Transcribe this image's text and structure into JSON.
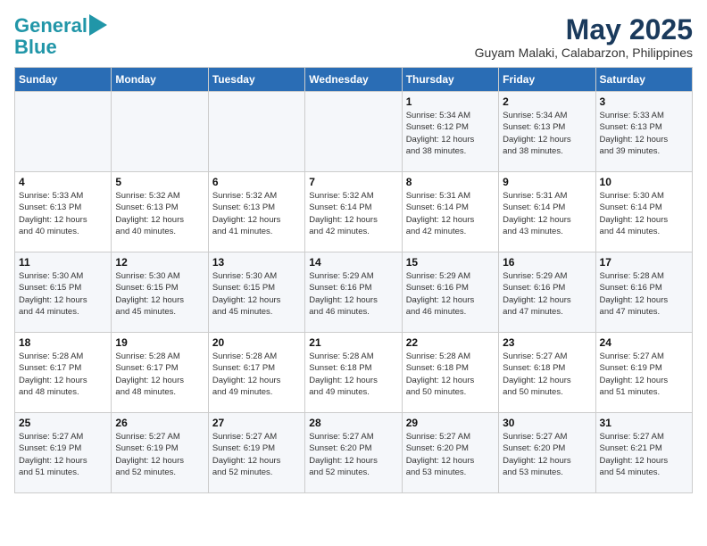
{
  "header": {
    "logo_line1": "General",
    "logo_line2": "Blue",
    "month_title": "May 2025",
    "location": "Guyam Malaki, Calabarzon, Philippines"
  },
  "days_of_week": [
    "Sunday",
    "Monday",
    "Tuesday",
    "Wednesday",
    "Thursday",
    "Friday",
    "Saturday"
  ],
  "weeks": [
    [
      {
        "day": "",
        "info": ""
      },
      {
        "day": "",
        "info": ""
      },
      {
        "day": "",
        "info": ""
      },
      {
        "day": "",
        "info": ""
      },
      {
        "day": "1",
        "info": "Sunrise: 5:34 AM\nSunset: 6:12 PM\nDaylight: 12 hours\nand 38 minutes."
      },
      {
        "day": "2",
        "info": "Sunrise: 5:34 AM\nSunset: 6:13 PM\nDaylight: 12 hours\nand 38 minutes."
      },
      {
        "day": "3",
        "info": "Sunrise: 5:33 AM\nSunset: 6:13 PM\nDaylight: 12 hours\nand 39 minutes."
      }
    ],
    [
      {
        "day": "4",
        "info": "Sunrise: 5:33 AM\nSunset: 6:13 PM\nDaylight: 12 hours\nand 40 minutes."
      },
      {
        "day": "5",
        "info": "Sunrise: 5:32 AM\nSunset: 6:13 PM\nDaylight: 12 hours\nand 40 minutes."
      },
      {
        "day": "6",
        "info": "Sunrise: 5:32 AM\nSunset: 6:13 PM\nDaylight: 12 hours\nand 41 minutes."
      },
      {
        "day": "7",
        "info": "Sunrise: 5:32 AM\nSunset: 6:14 PM\nDaylight: 12 hours\nand 42 minutes."
      },
      {
        "day": "8",
        "info": "Sunrise: 5:31 AM\nSunset: 6:14 PM\nDaylight: 12 hours\nand 42 minutes."
      },
      {
        "day": "9",
        "info": "Sunrise: 5:31 AM\nSunset: 6:14 PM\nDaylight: 12 hours\nand 43 minutes."
      },
      {
        "day": "10",
        "info": "Sunrise: 5:30 AM\nSunset: 6:14 PM\nDaylight: 12 hours\nand 44 minutes."
      }
    ],
    [
      {
        "day": "11",
        "info": "Sunrise: 5:30 AM\nSunset: 6:15 PM\nDaylight: 12 hours\nand 44 minutes."
      },
      {
        "day": "12",
        "info": "Sunrise: 5:30 AM\nSunset: 6:15 PM\nDaylight: 12 hours\nand 45 minutes."
      },
      {
        "day": "13",
        "info": "Sunrise: 5:30 AM\nSunset: 6:15 PM\nDaylight: 12 hours\nand 45 minutes."
      },
      {
        "day": "14",
        "info": "Sunrise: 5:29 AM\nSunset: 6:16 PM\nDaylight: 12 hours\nand 46 minutes."
      },
      {
        "day": "15",
        "info": "Sunrise: 5:29 AM\nSunset: 6:16 PM\nDaylight: 12 hours\nand 46 minutes."
      },
      {
        "day": "16",
        "info": "Sunrise: 5:29 AM\nSunset: 6:16 PM\nDaylight: 12 hours\nand 47 minutes."
      },
      {
        "day": "17",
        "info": "Sunrise: 5:28 AM\nSunset: 6:16 PM\nDaylight: 12 hours\nand 47 minutes."
      }
    ],
    [
      {
        "day": "18",
        "info": "Sunrise: 5:28 AM\nSunset: 6:17 PM\nDaylight: 12 hours\nand 48 minutes."
      },
      {
        "day": "19",
        "info": "Sunrise: 5:28 AM\nSunset: 6:17 PM\nDaylight: 12 hours\nand 48 minutes."
      },
      {
        "day": "20",
        "info": "Sunrise: 5:28 AM\nSunset: 6:17 PM\nDaylight: 12 hours\nand 49 minutes."
      },
      {
        "day": "21",
        "info": "Sunrise: 5:28 AM\nSunset: 6:18 PM\nDaylight: 12 hours\nand 49 minutes."
      },
      {
        "day": "22",
        "info": "Sunrise: 5:28 AM\nSunset: 6:18 PM\nDaylight: 12 hours\nand 50 minutes."
      },
      {
        "day": "23",
        "info": "Sunrise: 5:27 AM\nSunset: 6:18 PM\nDaylight: 12 hours\nand 50 minutes."
      },
      {
        "day": "24",
        "info": "Sunrise: 5:27 AM\nSunset: 6:19 PM\nDaylight: 12 hours\nand 51 minutes."
      }
    ],
    [
      {
        "day": "25",
        "info": "Sunrise: 5:27 AM\nSunset: 6:19 PM\nDaylight: 12 hours\nand 51 minutes."
      },
      {
        "day": "26",
        "info": "Sunrise: 5:27 AM\nSunset: 6:19 PM\nDaylight: 12 hours\nand 52 minutes."
      },
      {
        "day": "27",
        "info": "Sunrise: 5:27 AM\nSunset: 6:19 PM\nDaylight: 12 hours\nand 52 minutes."
      },
      {
        "day": "28",
        "info": "Sunrise: 5:27 AM\nSunset: 6:20 PM\nDaylight: 12 hours\nand 52 minutes."
      },
      {
        "day": "29",
        "info": "Sunrise: 5:27 AM\nSunset: 6:20 PM\nDaylight: 12 hours\nand 53 minutes."
      },
      {
        "day": "30",
        "info": "Sunrise: 5:27 AM\nSunset: 6:20 PM\nDaylight: 12 hours\nand 53 minutes."
      },
      {
        "day": "31",
        "info": "Sunrise: 5:27 AM\nSunset: 6:21 PM\nDaylight: 12 hours\nand 54 minutes."
      }
    ]
  ]
}
